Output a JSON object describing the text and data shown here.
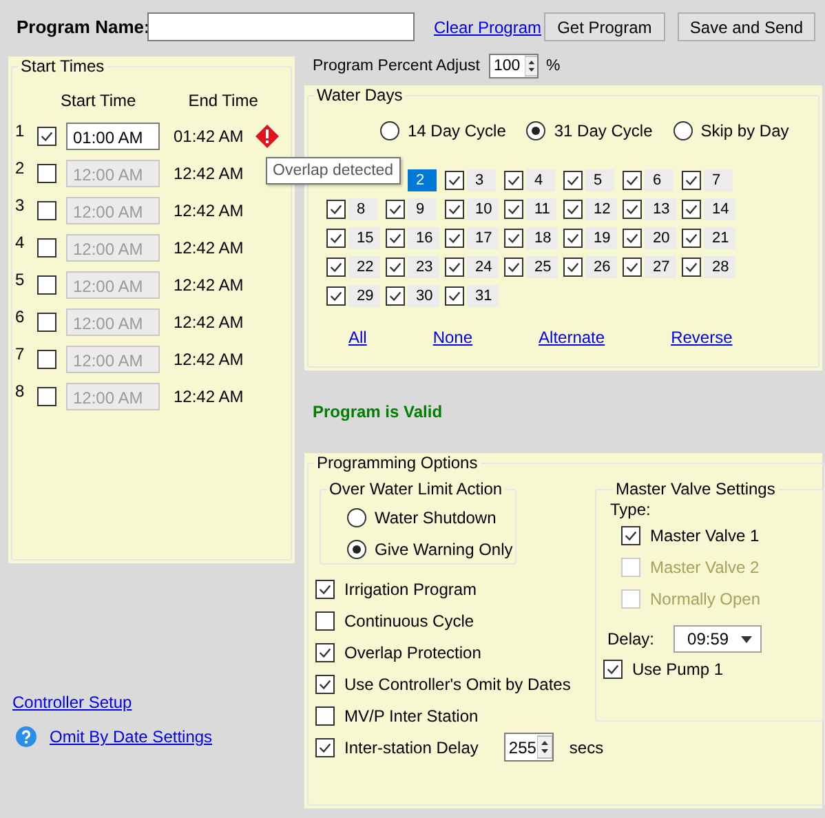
{
  "header": {
    "program_name_label": "Program Name:",
    "clear_link": "Clear Program",
    "buttons": [
      "Get Program",
      "Save and Send"
    ]
  },
  "start_times": {
    "title": "Start Times",
    "columns": [
      "Start Time",
      "End Time"
    ],
    "rows": [
      {
        "number": "1",
        "checked": true,
        "disabled": false,
        "start": "01:00 AM",
        "end": "01:42 AM",
        "warning": true
      },
      {
        "number": "2",
        "checked": false,
        "disabled": true,
        "start": "12:00 AM",
        "end": "12:42 AM",
        "warning": false
      },
      {
        "number": "3",
        "checked": false,
        "disabled": true,
        "start": "12:00 AM",
        "end": "12:42 AM",
        "warning": false
      },
      {
        "number": "4",
        "checked": false,
        "disabled": true,
        "start": "12:00 AM",
        "end": "12:42 AM",
        "warning": false
      },
      {
        "number": "5",
        "checked": false,
        "disabled": true,
        "start": "12:00 AM",
        "end": "12:42 AM",
        "warning": false
      },
      {
        "number": "6",
        "checked": false,
        "disabled": true,
        "start": "12:00 AM",
        "end": "12:42 AM",
        "warning": false
      },
      {
        "number": "7",
        "checked": false,
        "disabled": true,
        "start": "12:00 AM",
        "end": "12:42 AM",
        "warning": false
      },
      {
        "number": "8",
        "checked": false,
        "disabled": true,
        "start": "12:00 AM",
        "end": "12:42 AM",
        "warning": false
      }
    ]
  },
  "tooltip": "Overlap detected",
  "percent_adjust": {
    "label": "Program Percent Adjust",
    "value": "100",
    "unit": "%"
  },
  "water_days": {
    "title": "Water Days",
    "cycles": [
      {
        "label": "14 Day Cycle",
        "selected": false
      },
      {
        "label": "31 Day Cycle",
        "selected": true
      },
      {
        "label": "Skip by Day",
        "selected": false
      }
    ],
    "days": [
      {
        "label": "2",
        "focused": true
      },
      {
        "label": "3",
        "checked": true,
        "focused": false
      },
      {
        "label": "4",
        "checked": true,
        "focused": false
      },
      {
        "label": "5",
        "checked": true,
        "focused": false
      },
      {
        "label": "6",
        "checked": true,
        "focused": false
      },
      {
        "label": "7",
        "checked": true,
        "focused": false
      },
      {
        "label": "8",
        "checked": true,
        "focused": false
      },
      {
        "label": "9",
        "checked": true,
        "focused": false
      },
      {
        "label": "10",
        "checked": true,
        "focused": false
      },
      {
        "label": "11",
        "checked": true,
        "focused": false
      },
      {
        "label": "12",
        "checked": true,
        "focused": false
      },
      {
        "label": "13",
        "checked": true,
        "focused": false
      },
      {
        "label": "14",
        "checked": true,
        "focused": false
      },
      {
        "label": "15",
        "checked": true,
        "focused": false
      },
      {
        "label": "16",
        "checked": true,
        "focused": false
      },
      {
        "label": "17",
        "checked": true,
        "focused": false
      },
      {
        "label": "18",
        "checked": true,
        "focused": false
      },
      {
        "label": "19",
        "checked": true,
        "focused": false
      },
      {
        "label": "20",
        "checked": true,
        "focused": false
      },
      {
        "label": "21",
        "checked": true,
        "focused": false
      },
      {
        "label": "22",
        "checked": true,
        "focused": false
      },
      {
        "label": "23",
        "checked": true,
        "focused": false
      },
      {
        "label": "24",
        "checked": true,
        "focused": false
      },
      {
        "label": "25",
        "checked": true,
        "focused": false
      },
      {
        "label": "26",
        "checked": true,
        "focused": false
      },
      {
        "label": "27",
        "checked": true,
        "focused": false
      },
      {
        "label": "28",
        "checked": true,
        "focused": false
      },
      {
        "label": "29",
        "checked": true,
        "focused": false
      },
      {
        "label": "30",
        "checked": true,
        "focused": false
      },
      {
        "label": "31",
        "checked": true,
        "focused": false
      }
    ],
    "links": [
      "All",
      "None",
      "Alternate",
      "Reverse"
    ]
  },
  "status": "Program is Valid",
  "options": {
    "title": "Programming Options",
    "over_water": {
      "title": "Over Water Limit Action",
      "choices": [
        {
          "label": "Water Shutdown",
          "selected": false
        },
        {
          "label": "Give Warning Only",
          "selected": true
        }
      ]
    },
    "checks": [
      {
        "label": "Irrigation Program",
        "checked": true
      },
      {
        "label": "Continuous Cycle",
        "checked": false
      },
      {
        "label": "Overlap Protection",
        "checked": true
      },
      {
        "label": "Use Controller's Omit by Dates",
        "checked": true
      },
      {
        "label": "MV/P Inter Station",
        "checked": false
      },
      {
        "label": "Inter-station Delay",
        "checked": true,
        "spin": "255",
        "unit": "secs"
      }
    ],
    "master_valve": {
      "title": "Master Valve Settings",
      "type_label": "Type:",
      "valves": [
        {
          "label": "Master Valve 1",
          "checked": true,
          "disabled": false
        },
        {
          "label": "Master Valve 2",
          "checked": false,
          "disabled": true
        },
        {
          "label": "Normally Open",
          "checked": false,
          "disabled": true
        }
      ],
      "delay_label": "Delay:",
      "delay_value": "09:59",
      "pump": {
        "label": "Use Pump 1",
        "checked": true
      }
    }
  },
  "footer_links": [
    {
      "label": "Controller Setup",
      "help": false
    },
    {
      "label": "Omit By Date Settings",
      "help": true
    }
  ]
}
